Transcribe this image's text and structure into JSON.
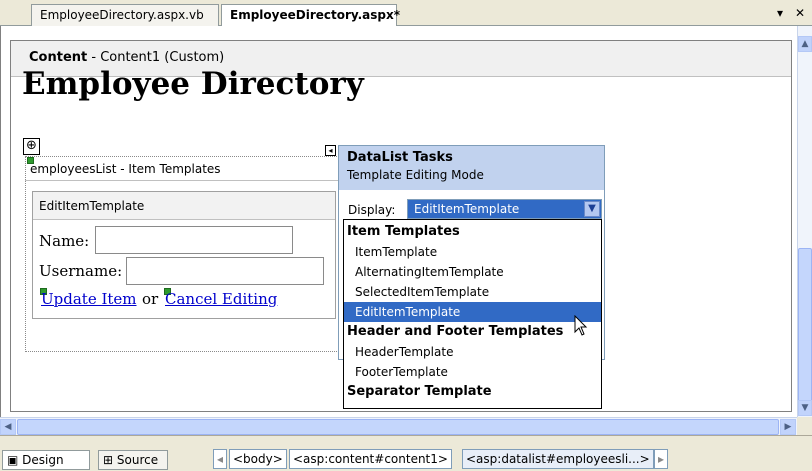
{
  "tabs": [
    {
      "label": "EmployeeDirectory.aspx.vb"
    },
    {
      "label": "EmployeeDirectory.aspx*"
    }
  ],
  "tab_controls": {
    "dropdown": "▾",
    "close": "✕"
  },
  "content_header": {
    "bold": "Content",
    "rest": " - Content1 (Custom)"
  },
  "page_heading": "Employee Directory",
  "datalist": {
    "title": "employeesList - Item Templates",
    "template_name": "EditItemTemplate",
    "name_label": "Name:",
    "username_label": "Username:",
    "update_link": "Update Item",
    "or_text": "or",
    "cancel_link": "Cancel Editing"
  },
  "tasks": {
    "title": "DataList Tasks",
    "subtitle": "Template Editing Mode",
    "display_label": "Display:",
    "selected": "EditItemTemplate"
  },
  "dropdown": [
    {
      "type": "group",
      "label": "Item Templates"
    },
    {
      "type": "item",
      "label": "ItemTemplate"
    },
    {
      "type": "item",
      "label": "AlternatingItemTemplate"
    },
    {
      "type": "item",
      "label": "SelectedItemTemplate"
    },
    {
      "type": "item",
      "label": "EditItemTemplate",
      "selected": true
    },
    {
      "type": "group",
      "label": "Header and Footer Templates"
    },
    {
      "type": "item",
      "label": "HeaderTemplate"
    },
    {
      "type": "item",
      "label": "FooterTemplate"
    },
    {
      "type": "group",
      "label": "Separator Template"
    }
  ],
  "bottom": {
    "design": "Design",
    "source": "Source",
    "crumbs": [
      "<body>",
      "<asp:content#content1>",
      "<asp:datalist#employeesli...>"
    ]
  }
}
